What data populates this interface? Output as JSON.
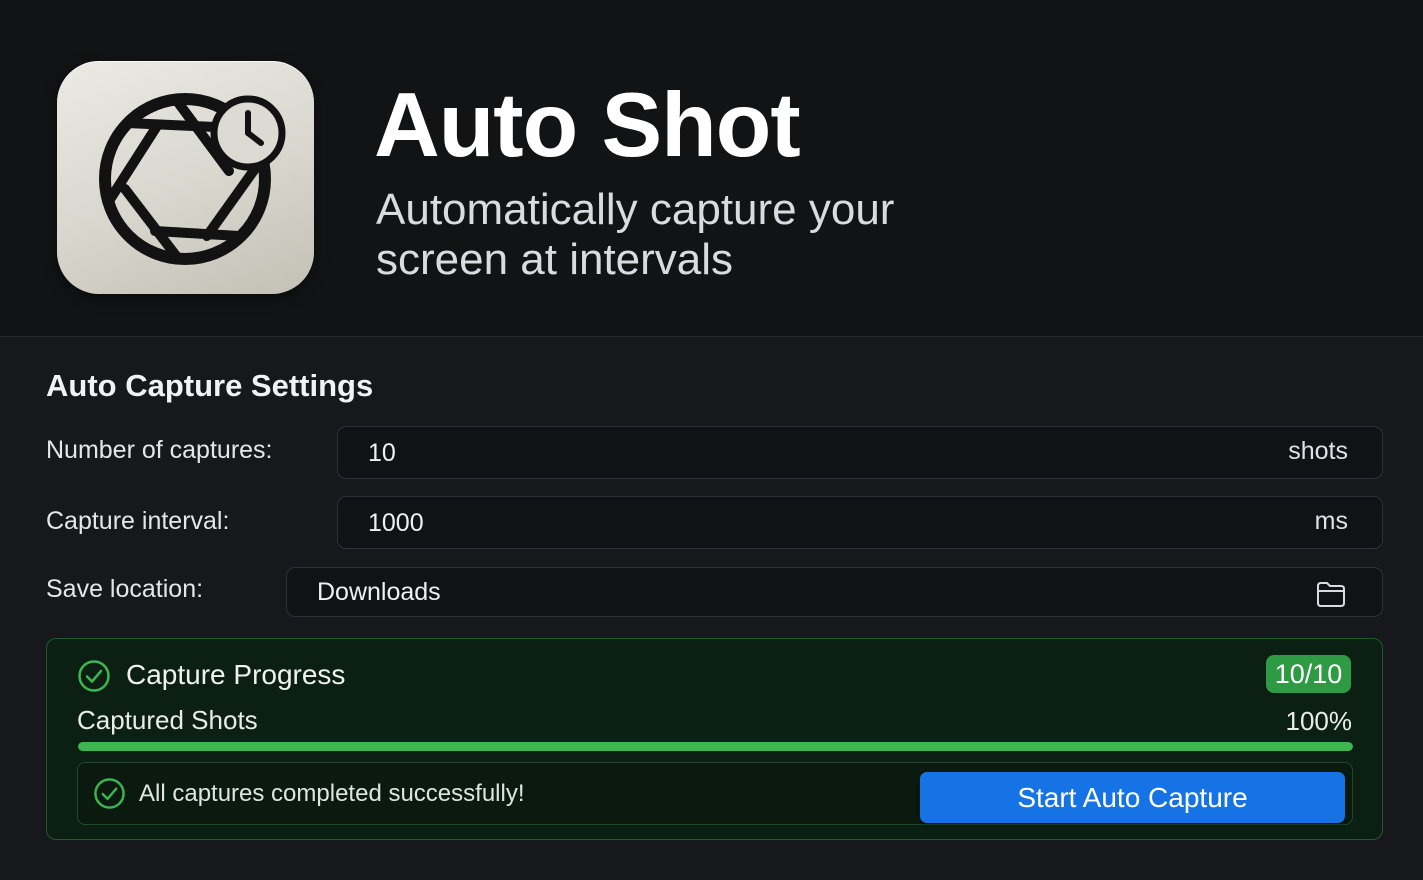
{
  "app": {
    "title": "Auto Shot",
    "subtitle": "Automatically capture your screen at intervals",
    "icon": "camera-aperture-clock-icon"
  },
  "settings": {
    "section_title": "Auto Capture Settings",
    "captures": {
      "label": "Number of captures:",
      "value": "10",
      "suffix": "shots"
    },
    "interval": {
      "label": "Capture interval:",
      "value": "1000",
      "suffix": "ms"
    },
    "location": {
      "label": "Save location:",
      "value": "Downloads",
      "icon": "folder-icon"
    }
  },
  "progress": {
    "title": "Capture Progress",
    "badge": "10/10",
    "captured_label": "Captured Shots",
    "percent_label": "100%",
    "percent": 100,
    "status_message": "All captures completed successfully!",
    "start_button": "Start Auto Capture"
  },
  "colors": {
    "accent_blue": "#1573e6",
    "success_green": "#3db652",
    "badge_green": "#2e9a44",
    "background": "#16181c"
  }
}
